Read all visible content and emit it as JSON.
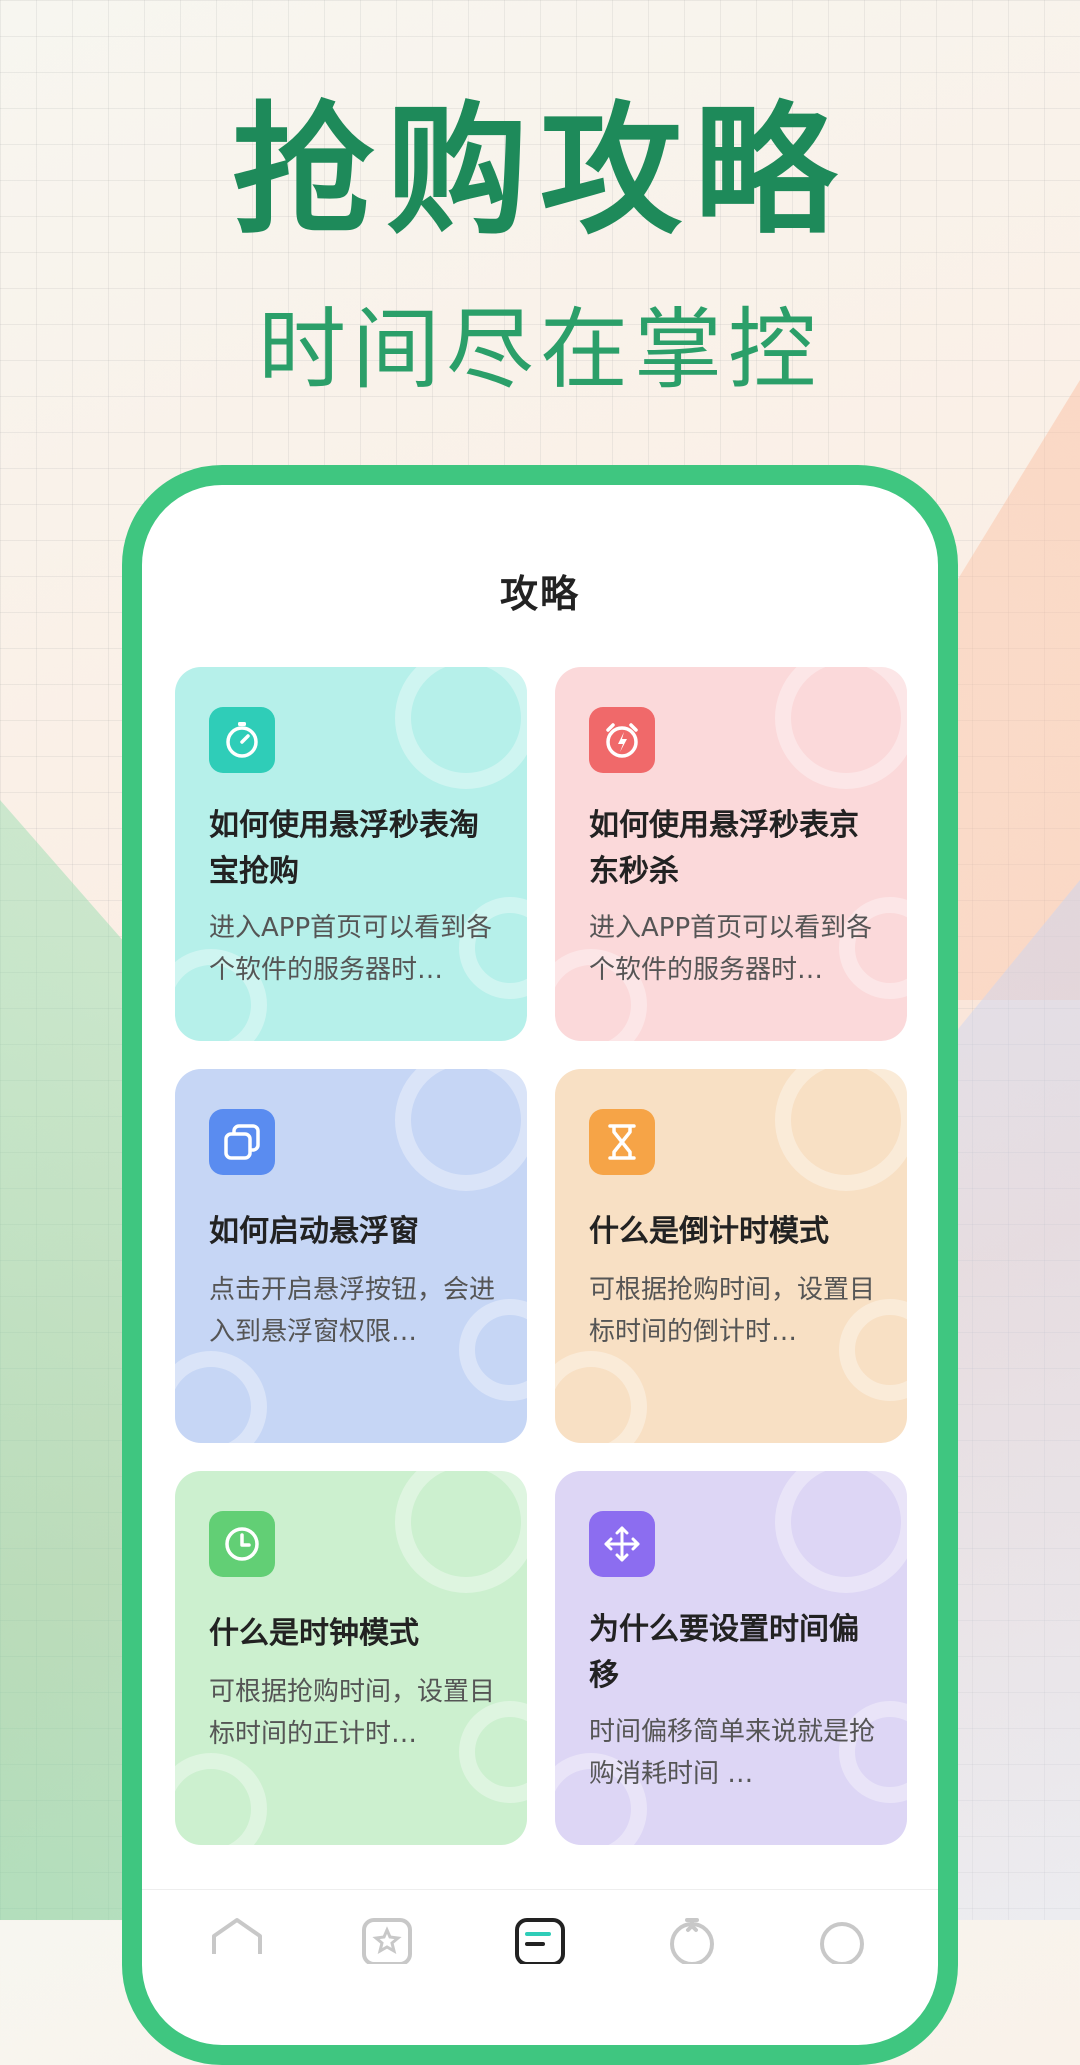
{
  "banner": {
    "title": "抢购攻略",
    "subtitle": "时间尽在掌控"
  },
  "screen": {
    "title": "攻略"
  },
  "cards": [
    {
      "title": "如何使用悬浮秒表淘宝抢购",
      "desc": "进入APP首页可以看到各个软件的服务器时…",
      "icon": "stopwatch-icon",
      "color": "#2fcdb8"
    },
    {
      "title": "如何使用悬浮秒表京东秒杀",
      "desc": "进入APP首页可以看到各个软件的服务器时…",
      "icon": "alarm-clock-icon",
      "color": "#f0696a"
    },
    {
      "title": "如何启动悬浮窗",
      "desc": "点击开启悬浮按钮，会进入到悬浮窗权限…",
      "icon": "windows-icon",
      "color": "#5a8cf0"
    },
    {
      "title": "什么是倒计时模式",
      "desc": "可根据抢购时间，设置目标时间的倒计时…",
      "icon": "hourglass-icon",
      "color": "#f6a447"
    },
    {
      "title": "什么是时钟模式",
      "desc": "可根据抢购时间，设置目标时间的正计时…",
      "icon": "clock-icon",
      "color": "#62cf75"
    },
    {
      "title": "为什么要设置时间偏移",
      "desc": "时间偏移简单来说就是抢购消耗时间 …",
      "icon": "move-arrows-icon",
      "color": "#8c6df0"
    }
  ],
  "tabbar": {
    "tabs": [
      "home-icon",
      "favorite-icon",
      "guide-icon",
      "timer-icon",
      "profile-icon"
    ]
  }
}
